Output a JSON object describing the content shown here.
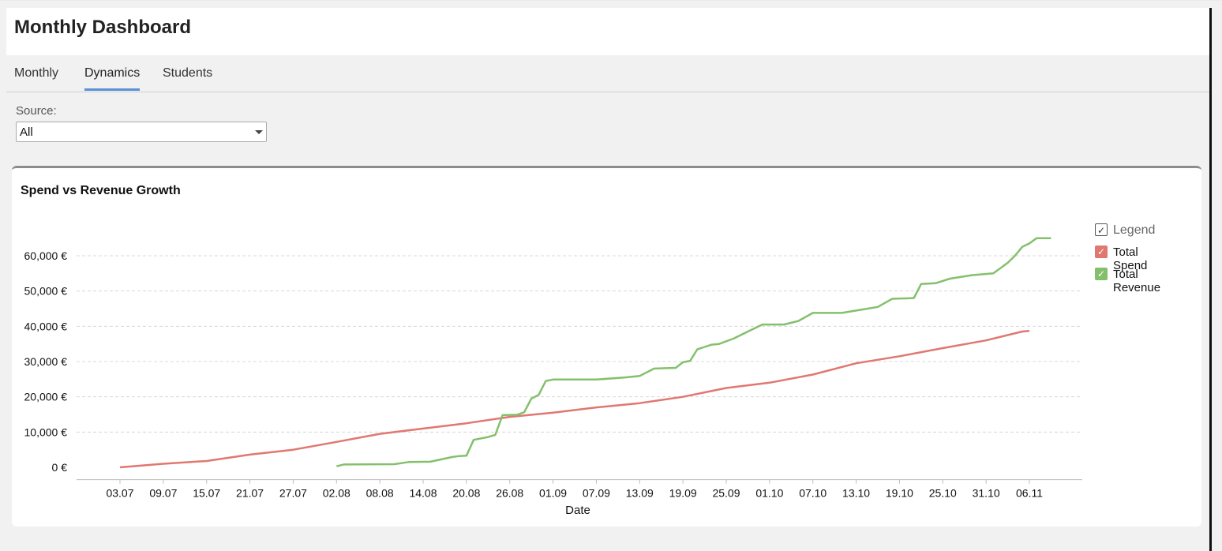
{
  "header": {
    "title": "Monthly Dashboard"
  },
  "tabs": [
    {
      "label": "Monthly",
      "active": false
    },
    {
      "label": "Dynamics",
      "active": true
    },
    {
      "label": "Students",
      "active": false
    }
  ],
  "filter": {
    "label": "Source:",
    "selected": "All"
  },
  "colors": {
    "spend": "#e07870",
    "revenue": "#84c06c",
    "tab_accent": "#5b8fd6"
  },
  "icons": {
    "check": "✓",
    "dropdown": "chevron-down-icon"
  },
  "card": {
    "title": "Spend vs Revenue Growth",
    "legend_title": "Legend",
    "legend_items": [
      "Total Spend",
      "Total Revenue"
    ]
  },
  "chart_data": {
    "type": "line",
    "title": "Spend vs Revenue Growth",
    "xlabel": "Date",
    "ylabel": "",
    "y_tick_labels": [
      "0 €",
      "10,000 €",
      "20,000 €",
      "30,000 €",
      "40,000 €",
      "50,000 €",
      "60,000 €"
    ],
    "y_ticks": [
      0,
      10000,
      20000,
      30000,
      40000,
      50000,
      60000
    ],
    "ylim": [
      -3500,
      65000
    ],
    "x_tick_labels": [
      "03.07",
      "09.07",
      "15.07",
      "21.07",
      "27.07",
      "02.08",
      "08.08",
      "14.08",
      "20.08",
      "26.08",
      "01.09",
      "07.09",
      "13.09",
      "19.09",
      "25.09",
      "01.10",
      "07.10",
      "13.10",
      "19.10",
      "25.10",
      "31.10",
      "06.11"
    ],
    "grid": true,
    "legend_position": "right",
    "series": [
      {
        "name": "Total Spend",
        "points": [
          [
            "03.07",
            0
          ],
          [
            "09.07",
            1000
          ],
          [
            "15.07",
            1800
          ],
          [
            "21.07",
            3600
          ],
          [
            "27.07",
            5000
          ],
          [
            "02.08",
            7200
          ],
          [
            "08.08",
            9500
          ],
          [
            "14.08",
            11000
          ],
          [
            "20.08",
            12500
          ],
          [
            "26.08",
            14300
          ],
          [
            "01.09",
            15500
          ],
          [
            "07.09",
            17000
          ],
          [
            "13.09",
            18200
          ],
          [
            "19.09",
            20000
          ],
          [
            "25.09",
            22500
          ],
          [
            "01.10",
            24000
          ],
          [
            "07.10",
            26300
          ],
          [
            "13.10",
            29500
          ],
          [
            "19.10",
            31500
          ],
          [
            "25.10",
            33800
          ],
          [
            "31.10",
            36000
          ],
          [
            "05.11",
            38500
          ],
          [
            "06.11",
            38700
          ]
        ]
      },
      {
        "name": "Total Revenue",
        "points": [
          [
            "02.08",
            300
          ],
          [
            "03.08",
            800
          ],
          [
            "10.08",
            900
          ],
          [
            "12.08",
            1500
          ],
          [
            "15.08",
            1600
          ],
          [
            "18.08",
            2900
          ],
          [
            "19.08",
            3200
          ],
          [
            "20.08",
            3300
          ],
          [
            "21.08",
            7800
          ],
          [
            "23.08",
            8600
          ],
          [
            "24.08",
            9200
          ],
          [
            "25.08",
            14800
          ],
          [
            "27.08",
            14900
          ],
          [
            "28.08",
            15600
          ],
          [
            "29.08",
            19500
          ],
          [
            "30.08",
            20500
          ],
          [
            "31.08",
            24500
          ],
          [
            "01.09",
            24900
          ],
          [
            "07.09",
            24900
          ],
          [
            "11.09",
            25500
          ],
          [
            "13.09",
            25900
          ],
          [
            "15.09",
            28000
          ],
          [
            "18.09",
            28200
          ],
          [
            "19.09",
            29800
          ],
          [
            "20.09",
            30200
          ],
          [
            "21.09",
            33500
          ],
          [
            "23.09",
            34800
          ],
          [
            "24.09",
            35000
          ],
          [
            "26.09",
            36500
          ],
          [
            "28.09",
            38500
          ],
          [
            "30.09",
            40500
          ],
          [
            "03.10",
            40500
          ],
          [
            "05.10",
            41500
          ],
          [
            "07.10",
            43800
          ],
          [
            "11.10",
            43800
          ],
          [
            "14.10",
            44800
          ],
          [
            "16.10",
            45500
          ],
          [
            "18.10",
            47800
          ],
          [
            "21.10",
            48000
          ],
          [
            "22.10",
            52000
          ],
          [
            "24.10",
            52200
          ],
          [
            "26.10",
            53500
          ],
          [
            "29.10",
            54500
          ],
          [
            "01.11",
            55000
          ],
          [
            "03.11",
            58000
          ],
          [
            "04.11",
            60000
          ],
          [
            "05.11",
            62500
          ],
          [
            "06.11",
            63500
          ],
          [
            "07.11",
            65000
          ],
          [
            "09.11",
            65000
          ]
        ]
      }
    ]
  }
}
